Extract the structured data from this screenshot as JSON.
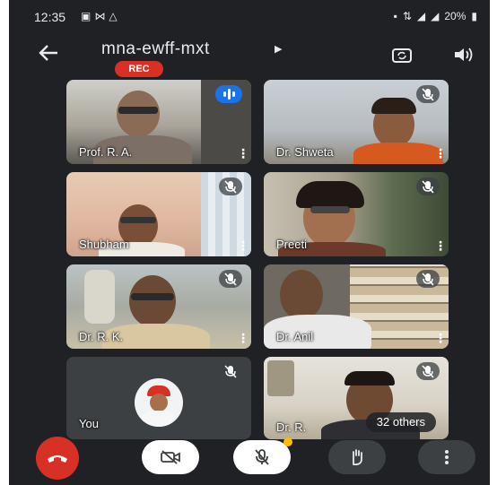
{
  "status_bar": {
    "time": "12:35",
    "notification_icons": [
      "message-icon",
      "mail-icon",
      "alert-icon"
    ],
    "battery_text": "20%"
  },
  "header": {
    "meeting_code": "mna-ewff-mxt",
    "rec_label": "REC",
    "icons": [
      "back-arrow-icon",
      "switch-camera-icon",
      "speaker-icon"
    ]
  },
  "participants": [
    {
      "name": "Prof. R. A.",
      "status": "speaking"
    },
    {
      "name": "Dr. Shweta",
      "status": "muted"
    },
    {
      "name": "Shubham",
      "status": "muted"
    },
    {
      "name": "Preeti",
      "status": "muted"
    },
    {
      "name": "Dr. R. K.",
      "status": "muted"
    },
    {
      "name": "Dr. Anil",
      "status": "muted"
    },
    {
      "name": "You",
      "status": "muted"
    },
    {
      "name": "Dr. R.",
      "status": "muted"
    }
  ],
  "others_label": "32 others",
  "controls": {
    "end_call": "phone-hangup-icon",
    "camera": "camera-off-icon",
    "mic": "mic-off-icon",
    "raise_hand": "hand-icon",
    "more": "more-vertical-icon"
  },
  "colors": {
    "background": "#202124",
    "end_call": "#d93025",
    "rec_badge": "#d93025",
    "speaking": "#1a73e8",
    "notify_dot": "#fbbc04"
  }
}
